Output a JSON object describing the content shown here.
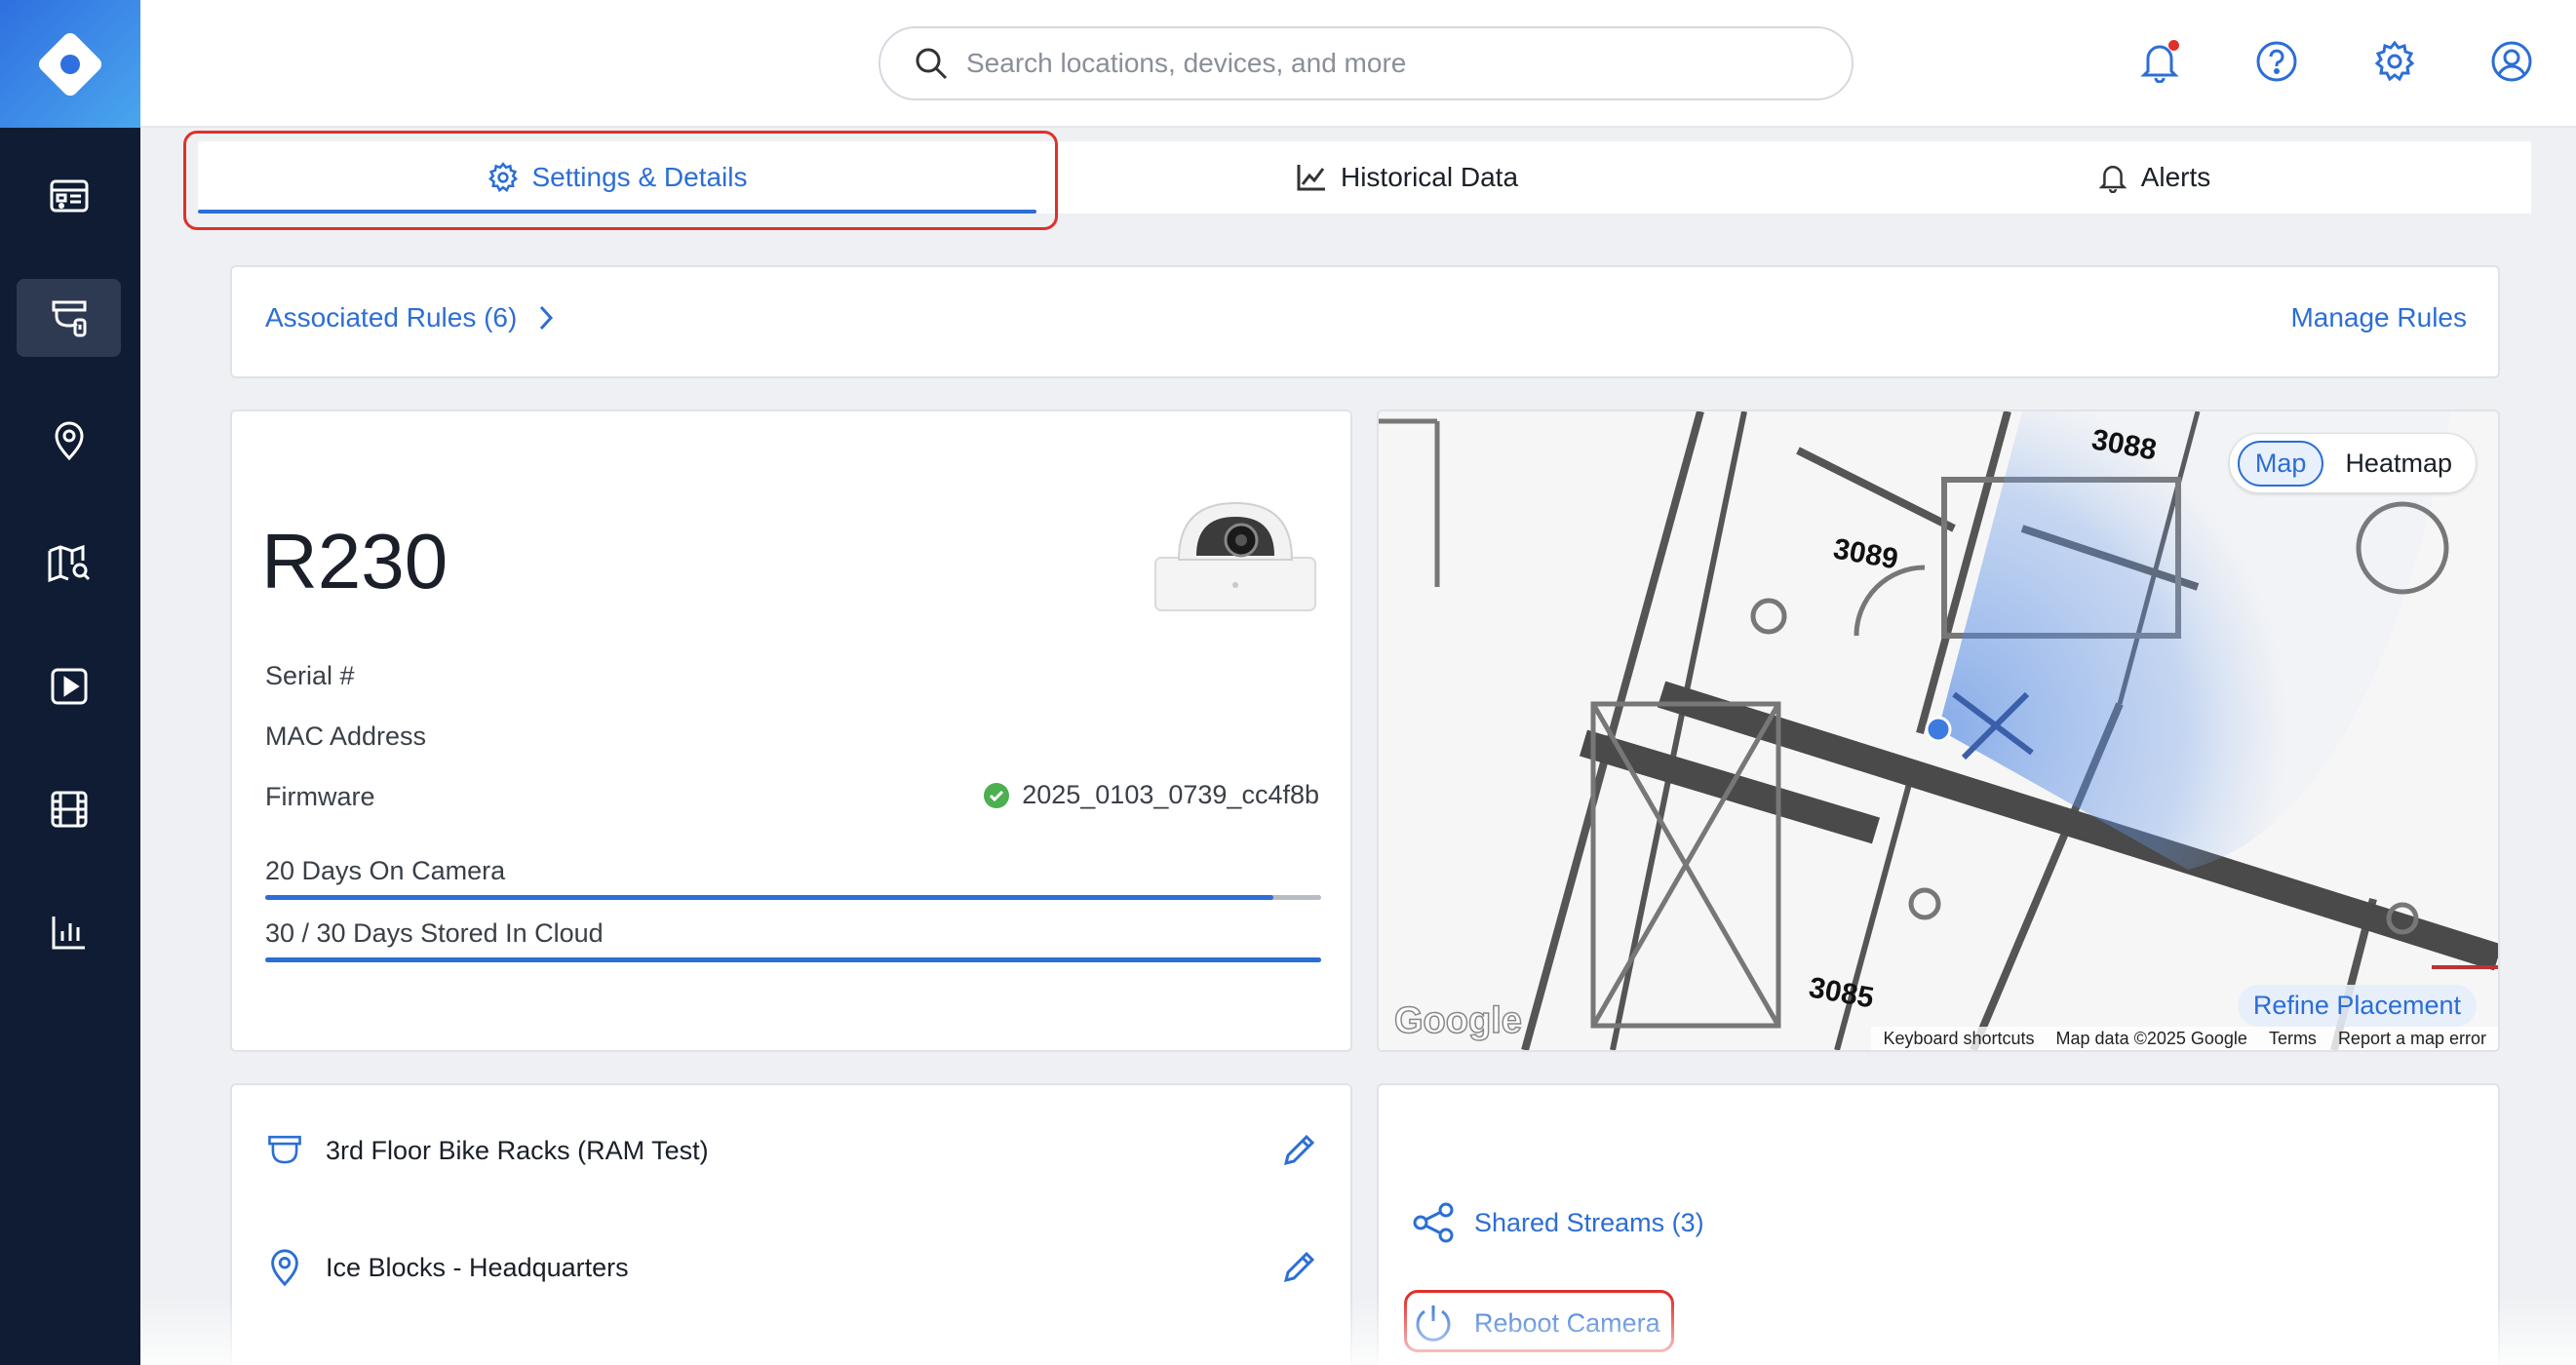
{
  "search": {
    "placeholder": "Search locations, devices, and more"
  },
  "sidebar": {
    "items": [
      {
        "icon": "dashboard-icon",
        "active": false
      },
      {
        "icon": "camera-icon",
        "active": true
      },
      {
        "icon": "location-pin-icon",
        "active": false
      },
      {
        "icon": "map-search-icon",
        "active": false
      },
      {
        "icon": "video-wall-icon",
        "active": false
      },
      {
        "icon": "film-icon",
        "active": false
      },
      {
        "icon": "bar-chart-icon",
        "active": false
      }
    ]
  },
  "header_icons": [
    "bell-icon",
    "help-icon",
    "gear-icon",
    "user-icon"
  ],
  "tabs": [
    {
      "label": "Settings & Details",
      "icon": "gear-icon",
      "active": true
    },
    {
      "label": "Historical Data",
      "icon": "line-chart-icon",
      "active": false
    },
    {
      "label": "Alerts",
      "icon": "bell-icon",
      "active": false
    }
  ],
  "rules": {
    "associated": "Associated Rules (6)",
    "manage": "Manage Rules"
  },
  "camera": {
    "name": "R230",
    "serial_label": "Serial #",
    "mac_label": "MAC Address",
    "firmware_label": "Firmware",
    "firmware_value": "2025_0103_0739_cc4f8b",
    "days_on_camera": "20 Days On Camera",
    "days_on_camera_fraction": 0.955,
    "cloud_storage": "30 / 30 Days Stored In Cloud",
    "cloud_storage_fraction": 1.0
  },
  "map": {
    "toggle_map": "Map",
    "toggle_heatmap": "Heatmap",
    "refine": "Refine Placement",
    "google": "Google",
    "shortcuts": "Keyboard shortcuts",
    "data": "Map data ©2025 Google",
    "terms": "Terms",
    "report": "Report a map error",
    "room_labels": [
      "3088",
      "3089",
      "3085"
    ]
  },
  "location": {
    "area": "3rd Floor Bike Racks (RAM Test)",
    "site": "Ice Blocks - Headquarters"
  },
  "actions": {
    "shared_streams": "Shared Streams (3)",
    "reboot": "Reboot Camera"
  },
  "colors": {
    "accent": "#2c6ed5",
    "sidebar": "#0f1c33",
    "highlight": "#e0302b",
    "success": "#4caf50"
  }
}
